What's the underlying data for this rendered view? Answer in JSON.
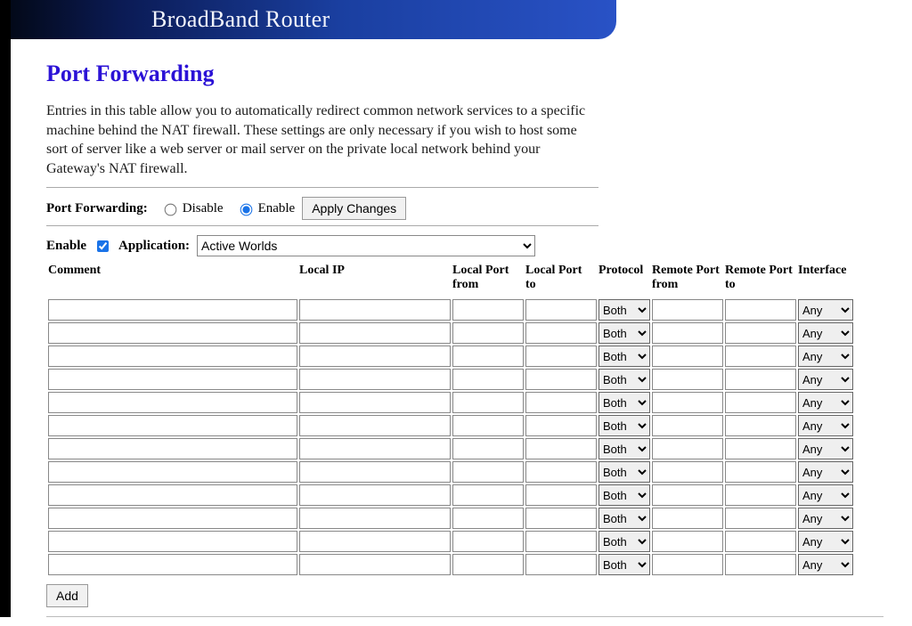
{
  "header": {
    "title": "BroadBand Router"
  },
  "page": {
    "title": "Port Forwarding",
    "description": "Entries in this table allow you to automatically redirect common network services to a specific machine behind the NAT firewall. These settings are only necessary if you wish to host some sort of server like a web server or mail server on the private local network behind your Gateway's NAT firewall."
  },
  "controls": {
    "pf_label": "Port Forwarding:",
    "disable_label": "Disable",
    "enable_label": "Enable",
    "apply_label": "Apply Changes",
    "pf_selected": "enable"
  },
  "entry": {
    "enable_label": "Enable",
    "enable_checked": true,
    "application_label": "Application:",
    "application_selected": "Active Worlds",
    "application_options": [
      "Active Worlds"
    ]
  },
  "table": {
    "columns": {
      "comment": "Comment",
      "local_ip": "Local IP",
      "local_port_from": "Local Port from",
      "local_port_to": "Local Port to",
      "protocol": "Protocol",
      "remote_port_from": "Remote Port from",
      "remote_port_to": "Remote Port to",
      "interface": "Interface"
    },
    "protocol_options": [
      "Both"
    ],
    "interface_options": [
      "Any"
    ],
    "rows": [
      {
        "comment": "",
        "local_ip": "",
        "lpf": "",
        "lpt": "",
        "protocol": "Both",
        "rpf": "",
        "rpt": "",
        "iface": "Any"
      },
      {
        "comment": "",
        "local_ip": "",
        "lpf": "",
        "lpt": "",
        "protocol": "Both",
        "rpf": "",
        "rpt": "",
        "iface": "Any"
      },
      {
        "comment": "",
        "local_ip": "",
        "lpf": "",
        "lpt": "",
        "protocol": "Both",
        "rpf": "",
        "rpt": "",
        "iface": "Any"
      },
      {
        "comment": "",
        "local_ip": "",
        "lpf": "",
        "lpt": "",
        "protocol": "Both",
        "rpf": "",
        "rpt": "",
        "iface": "Any"
      },
      {
        "comment": "",
        "local_ip": "",
        "lpf": "",
        "lpt": "",
        "protocol": "Both",
        "rpf": "",
        "rpt": "",
        "iface": "Any"
      },
      {
        "comment": "",
        "local_ip": "",
        "lpf": "",
        "lpt": "",
        "protocol": "Both",
        "rpf": "",
        "rpt": "",
        "iface": "Any"
      },
      {
        "comment": "",
        "local_ip": "",
        "lpf": "",
        "lpt": "",
        "protocol": "Both",
        "rpf": "",
        "rpt": "",
        "iface": "Any"
      },
      {
        "comment": "",
        "local_ip": "",
        "lpf": "",
        "lpt": "",
        "protocol": "Both",
        "rpf": "",
        "rpt": "",
        "iface": "Any"
      },
      {
        "comment": "",
        "local_ip": "",
        "lpf": "",
        "lpt": "",
        "protocol": "Both",
        "rpf": "",
        "rpt": "",
        "iface": "Any"
      },
      {
        "comment": "",
        "local_ip": "",
        "lpf": "",
        "lpt": "",
        "protocol": "Both",
        "rpf": "",
        "rpt": "",
        "iface": "Any"
      },
      {
        "comment": "",
        "local_ip": "",
        "lpf": "",
        "lpt": "",
        "protocol": "Both",
        "rpf": "",
        "rpt": "",
        "iface": "Any"
      },
      {
        "comment": "",
        "local_ip": "",
        "lpf": "",
        "lpt": "",
        "protocol": "Both",
        "rpf": "",
        "rpt": "",
        "iface": "Any"
      }
    ]
  },
  "buttons": {
    "add_label": "Add"
  }
}
